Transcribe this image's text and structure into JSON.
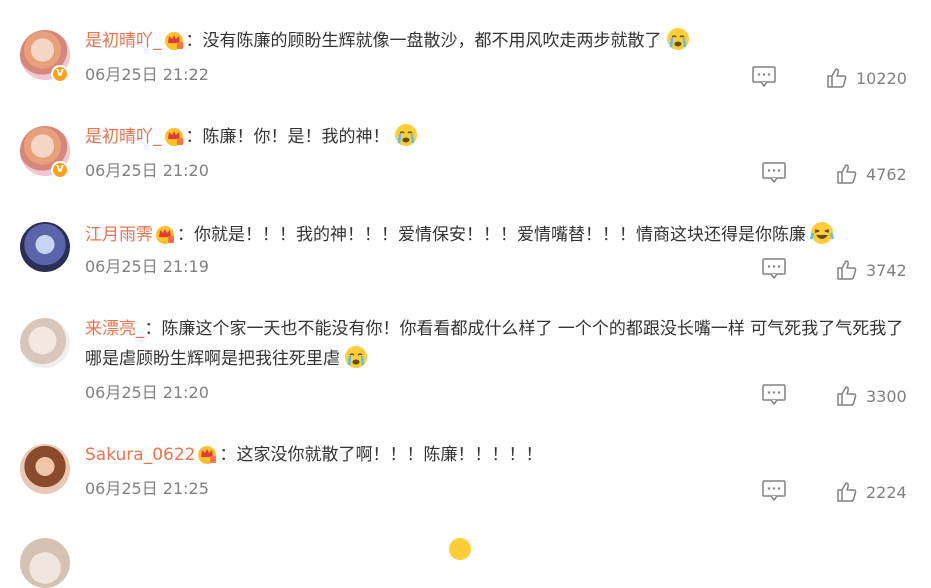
{
  "comments": [
    {
      "username": "是初晴吖_",
      "separator": "：",
      "text": "没有陈廉的顾盼生辉就像一盘散沙，都不用风吹走两步就散了",
      "time": "06月25日 21:22",
      "likes": "10220",
      "verified_badge": "V",
      "emoji": "crying-emoji"
    },
    {
      "username": "是初晴吖_",
      "separator": "：",
      "text": "陈廉！你！是！我的神！",
      "time": "06月25日 21:20",
      "likes": "4762",
      "verified_badge": "V",
      "emoji": "crying-emoji"
    },
    {
      "username": "江月雨霁",
      "separator": "：",
      "text": "你就是！！！我的神！！！爱情保安！！！爱情嘴替！！！情商这块还得是你陈廉",
      "time": "06月25日 21:19",
      "likes": "3742",
      "emoji": "laugh-cry-emoji"
    },
    {
      "username": "来漂亮_",
      "separator": "：",
      "text": "陈廉这个家一天也不能没有你！你看看都成什么样了 一个个的都跟没长嘴一样 可气死我了气死我了 哪是虐顾盼生辉啊是把我往死里虐",
      "time": "06月25日 21:20",
      "likes": "3300",
      "emoji": "crying-emoji"
    },
    {
      "username": "Sakura_0622",
      "separator": "：",
      "text": "这家没你就散了啊！！！陈廉！！！！！",
      "time": "06月25日 21:25",
      "likes": "2224"
    }
  ],
  "colors": {
    "username": "#eb7350",
    "text": "#333333",
    "meta": "#808080",
    "badge": "#f9a21b"
  }
}
